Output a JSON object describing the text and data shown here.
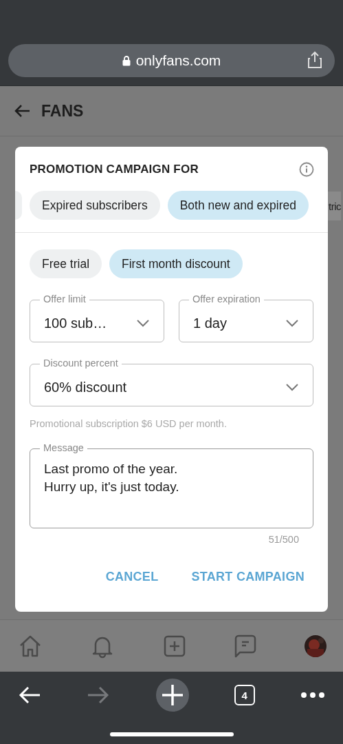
{
  "browser": {
    "url": "onlyfans.com",
    "tab_count": "4"
  },
  "page": {
    "title": "FANS",
    "behind_text": "tric"
  },
  "dialog": {
    "title": "PROMOTION CAMPAIGN FOR",
    "audience": [
      {
        "label": "Expired subscribers",
        "selected": false
      },
      {
        "label": "Both new and expired",
        "selected": true
      }
    ],
    "offer_types": [
      {
        "label": "Free trial",
        "selected": false
      },
      {
        "label": "First month discount",
        "selected": true
      }
    ],
    "field_rows": [
      [
        {
          "label": "Offer limit",
          "value": "100 sub…"
        },
        {
          "label": "Offer expiration",
          "value": "1 day"
        }
      ],
      [
        {
          "label": "Discount percent",
          "value": "60% discount"
        }
      ]
    ],
    "helper": "Promotional subscription $6 USD per month.",
    "message": {
      "label": "Message",
      "value": "Last promo of the year.\nHurry up, it's just today."
    },
    "counter": "51/500",
    "buttons": [
      "CANCEL",
      "START CAMPAIGN"
    ]
  }
}
